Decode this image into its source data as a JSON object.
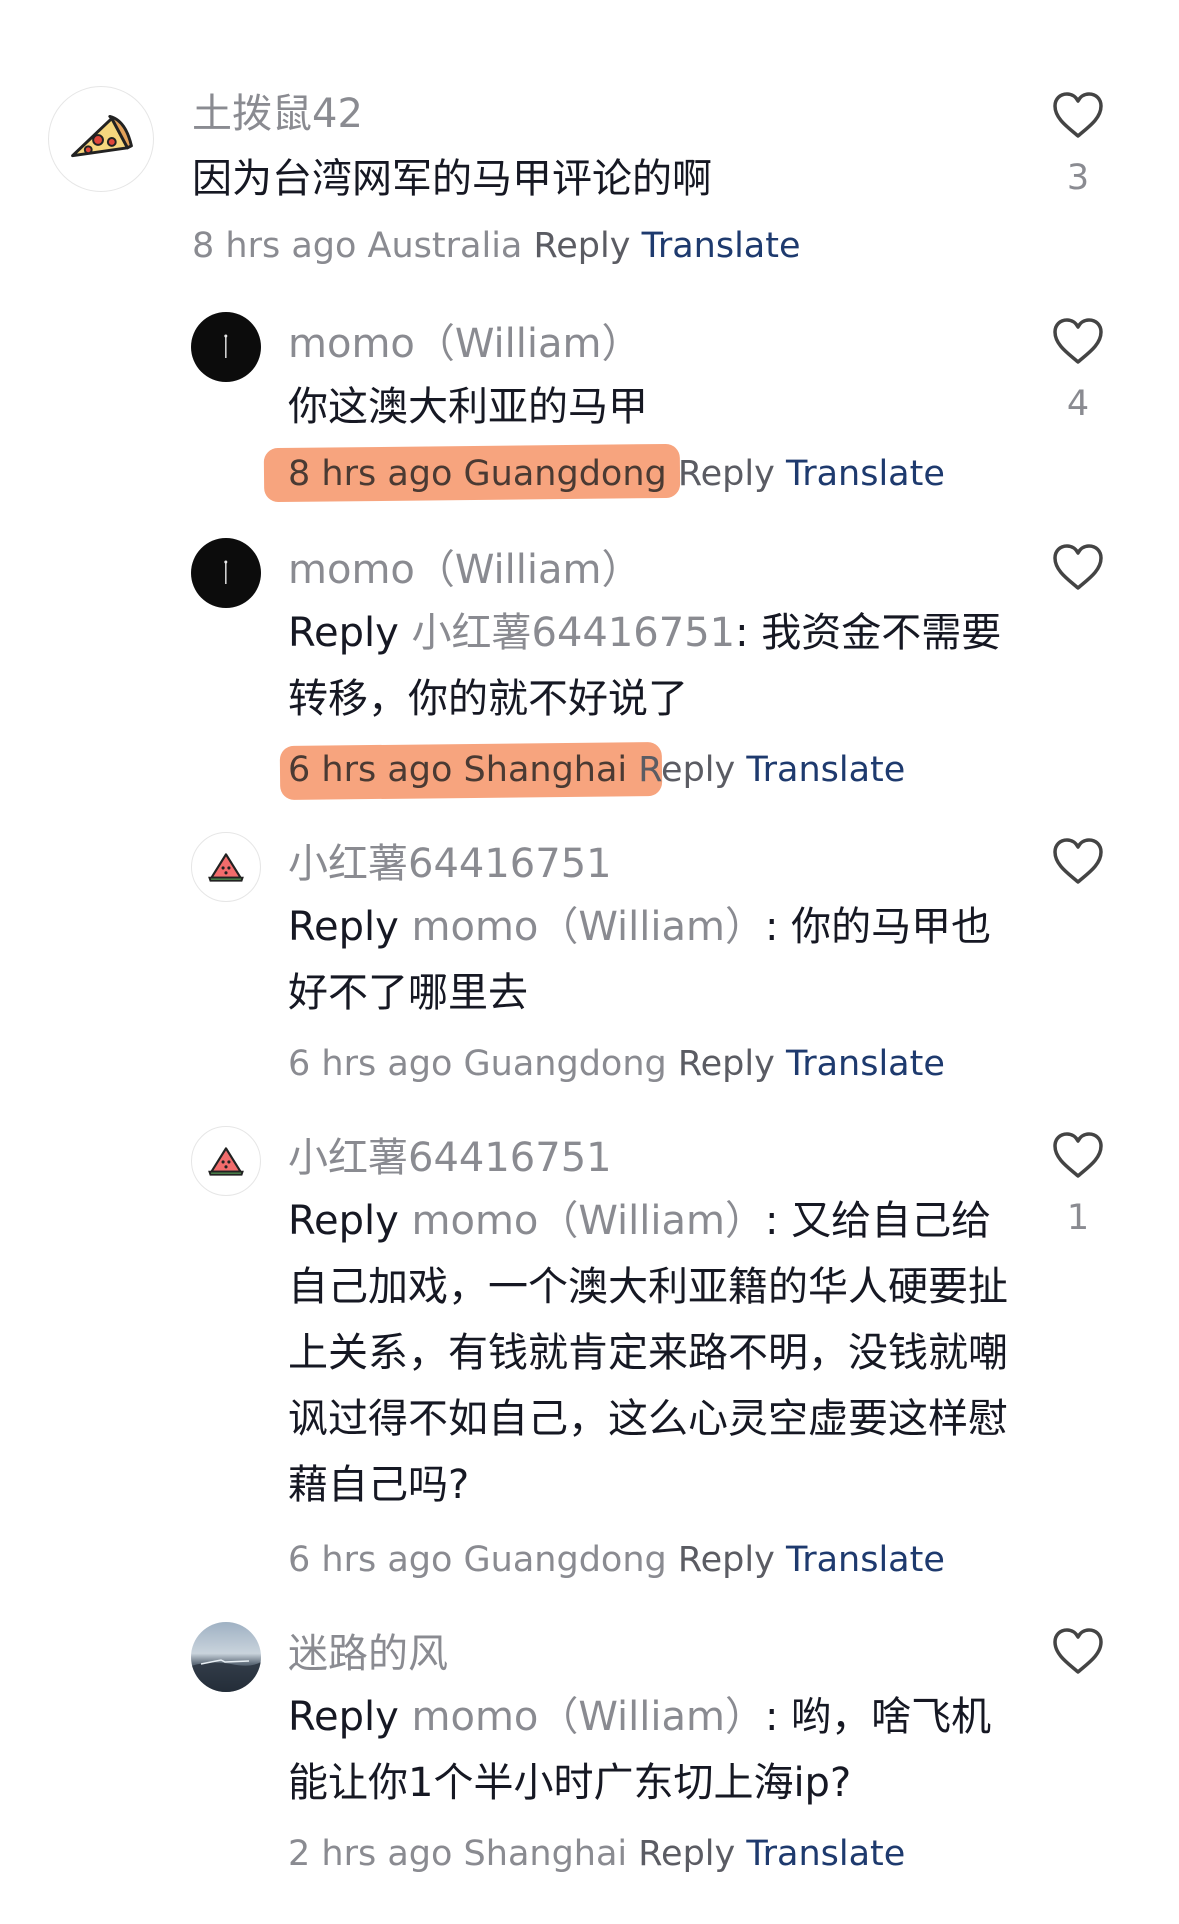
{
  "comments": [
    {
      "username": "土拨鼠42",
      "text": "因为台湾网军的马甲评论的啊",
      "timestamp": "8 hrs ago",
      "location": "Australia",
      "reply_label": "Reply",
      "translate_label": "Translate",
      "likes": "3",
      "avatar_icon": "pizza-icon"
    },
    {
      "username": "momo（William）",
      "text": "你这澳大利亚的马甲",
      "timestamp": "8 hrs ago",
      "location": "Guangdong",
      "reply_label": "Reply",
      "translate_label": "Translate",
      "likes": "4",
      "highlight_color": "#f58b5a",
      "avatar_icon": "dark-photo-avatar"
    },
    {
      "username": "momo（William）",
      "reply_prefix": "Reply",
      "reply_to": "小红薯64416751",
      "text": ": 我资金不需要转移，你的就不好说了",
      "timestamp": "6 hrs ago",
      "location": "Shanghai",
      "reply_label": "Reply",
      "translate_label": "Translate",
      "likes": "",
      "highlight_color": "#f58b5a",
      "avatar_icon": "dark-photo-avatar"
    },
    {
      "username": "小红薯64416751",
      "reply_prefix": "Reply",
      "reply_to": "momo（William）",
      "text": ": 你的马甲也好不了哪里去",
      "timestamp": "6 hrs ago",
      "location": "Guangdong",
      "reply_label": "Reply",
      "translate_label": "Translate",
      "likes": "",
      "avatar_icon": "watermelon-icon"
    },
    {
      "username": "小红薯64416751",
      "reply_prefix": "Reply",
      "reply_to": "momo（William）",
      "text": ": 又给自己给自己加戏，一个澳大利亚籍的华人硬要扯上关系，有钱就肯定来路不明，没钱就嘲讽过得不如自己，这么心灵空虚要这样慰藉自己吗?",
      "timestamp": "6 hrs ago",
      "location": "Guangdong",
      "reply_label": "Reply",
      "translate_label": "Translate",
      "likes": "1",
      "avatar_icon": "watermelon-icon"
    },
    {
      "username": "迷路的风",
      "reply_prefix": "Reply",
      "reply_to": "momo（William）",
      "text": ": 哟，啥飞机能让你1个半小时广东切上海ip?",
      "timestamp": "2 hrs ago",
      "location": "Shanghai",
      "reply_label": "Reply",
      "translate_label": "Translate",
      "likes": "",
      "avatar_icon": "landscape-photo-avatar"
    }
  ],
  "colors": {
    "username": "#8a8b91",
    "text": "#161823",
    "translate": "#1e3a6e",
    "highlight": "#f58b5a"
  }
}
